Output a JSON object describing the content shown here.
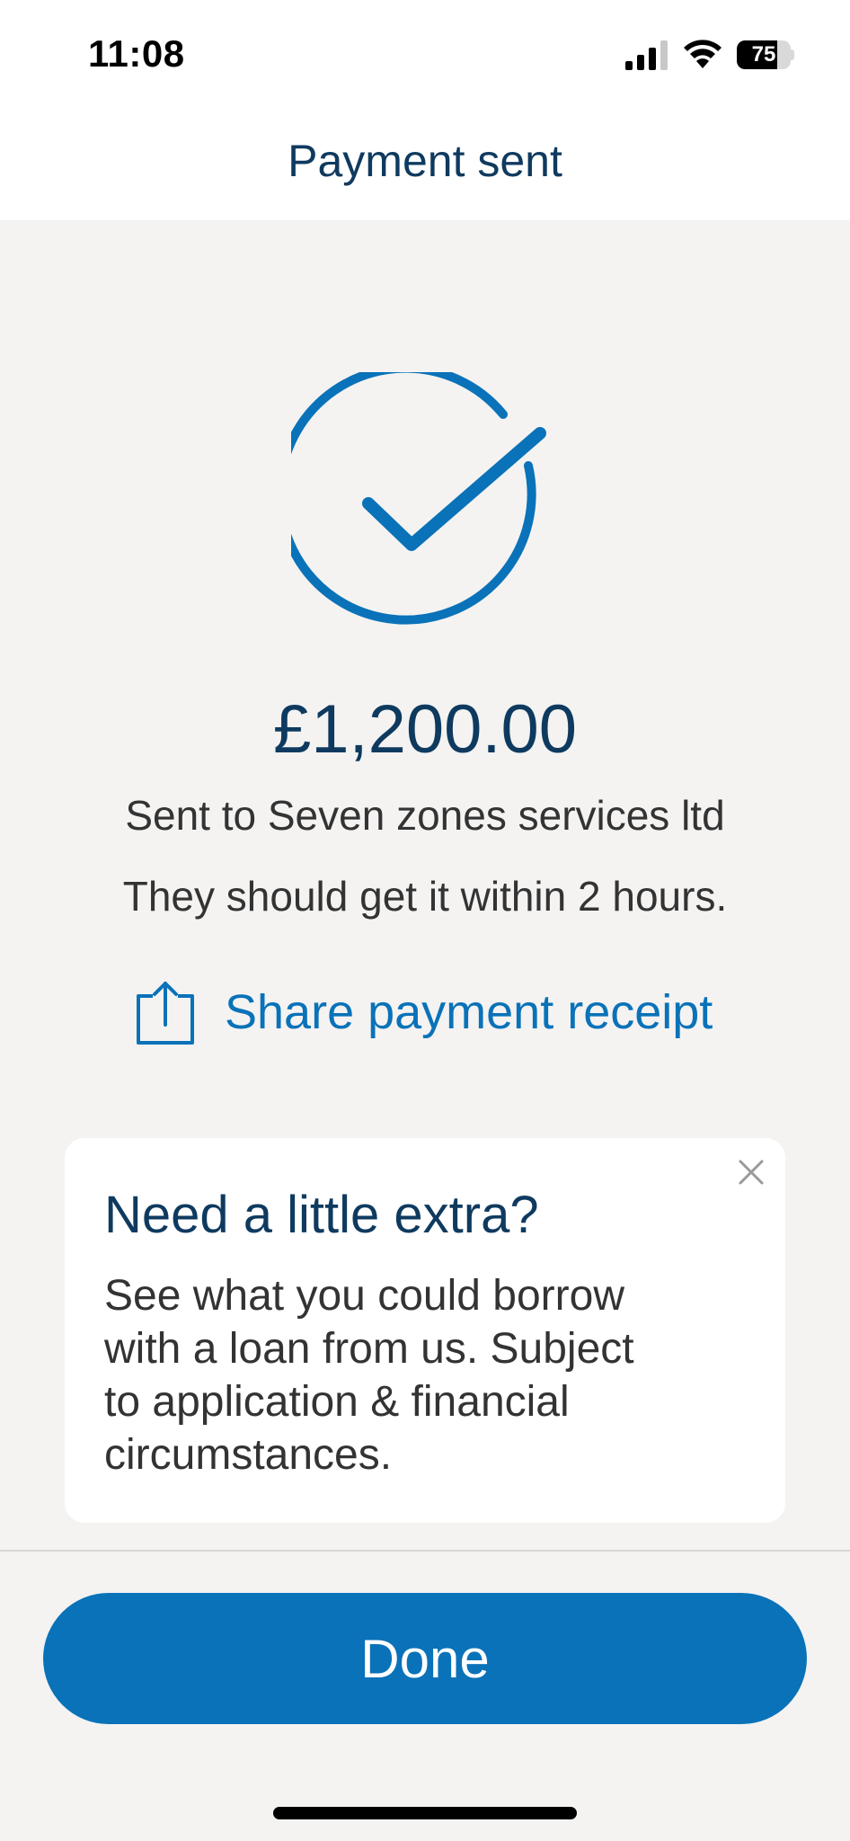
{
  "status_bar": {
    "time": "11:08",
    "battery_level": "75",
    "battery_fraction": 0.75,
    "icons": [
      "signal-icon",
      "wifi-icon",
      "battery-icon"
    ]
  },
  "header": {
    "title": "Payment sent"
  },
  "confirmation": {
    "icon": "check-circle-icon",
    "amount": "£1,200.00",
    "recipient_text": "Sent to Seven zones services ltd",
    "eta_text": "They should get it within 2 hours.",
    "share_label": "Share payment receipt",
    "share_icon": "share-icon"
  },
  "promo": {
    "title": "Need a little extra?",
    "body": "See what you could borrow with a loan from us. Subject to application & financial circumstances.",
    "close_icon": "close-icon"
  },
  "footer": {
    "done_label": "Done"
  },
  "colors": {
    "brand_blue": "#0a72b8",
    "title_navy": "#0f3a5f",
    "body_text": "#333333",
    "background": "#f4f3f2"
  }
}
